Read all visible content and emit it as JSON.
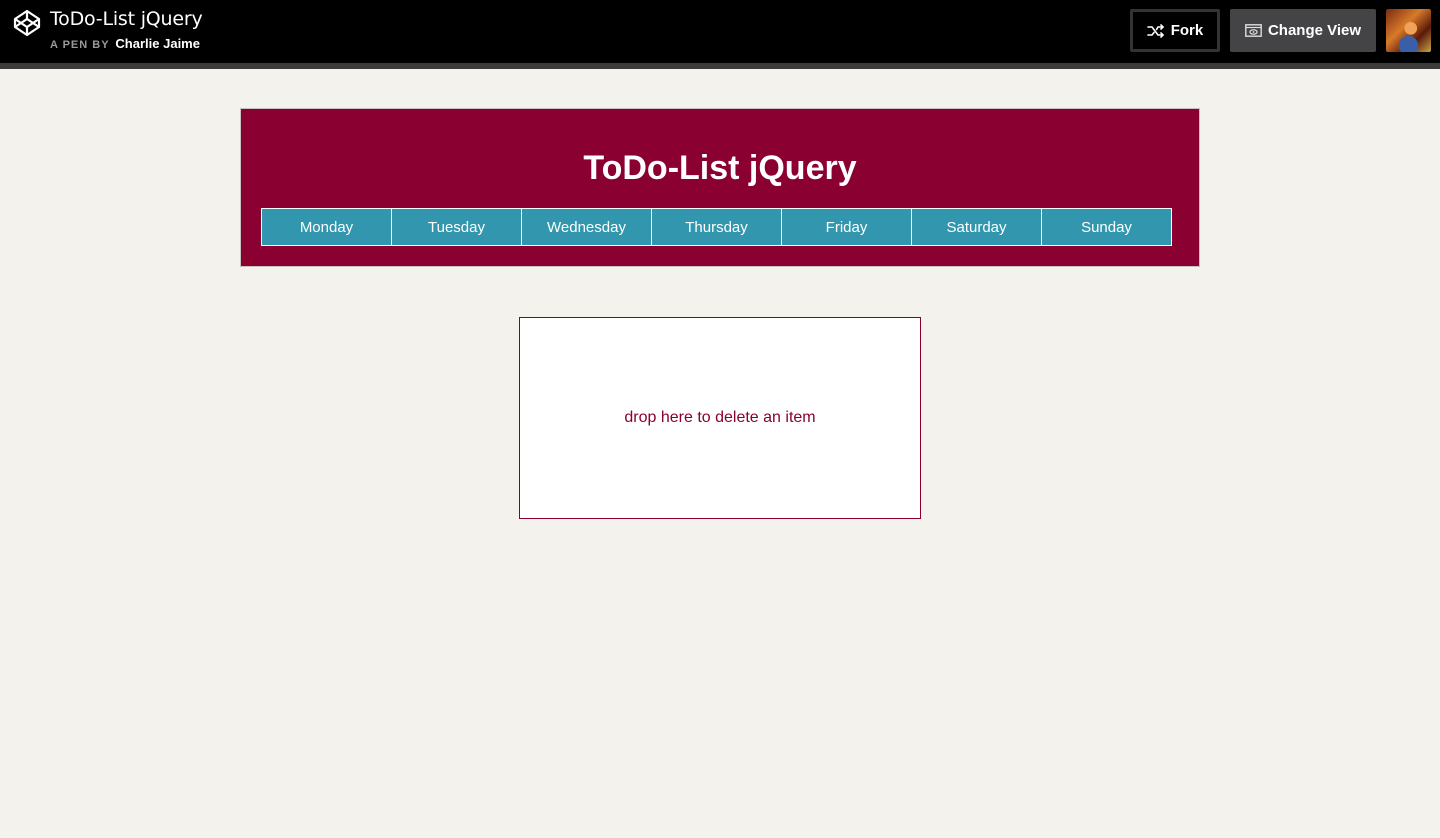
{
  "topbar": {
    "pen_title": "ToDo-List jQuery",
    "pen_by": "A PEN BY",
    "author": "Charlie Jaime",
    "fork_label": "Fork",
    "change_view_label": "Change View"
  },
  "app": {
    "title": "ToDo-List jQuery",
    "days": [
      "Monday",
      "Tuesday",
      "Wednesday",
      "Thursday",
      "Friday",
      "Saturday",
      "Sunday"
    ],
    "drop_zone_text": "drop here to delete an item"
  },
  "colors": {
    "header_bg": "#8a0031",
    "day_tab_bg": "#3196ae",
    "page_bg": "#f4f2ed"
  }
}
